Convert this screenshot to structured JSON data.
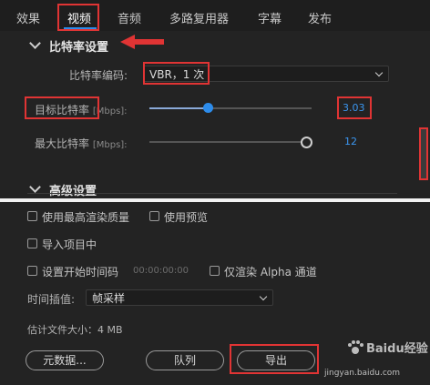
{
  "tabs": [
    {
      "label": "效果"
    },
    {
      "label": "视频"
    },
    {
      "label": "音频"
    },
    {
      "label": "多路复用器"
    },
    {
      "label": "字幕"
    },
    {
      "label": "发布"
    }
  ],
  "bitrate_section": {
    "title": "比特率设置",
    "encoding_label": "比特率编码:",
    "encoding_value": "VBR，1 次",
    "target_label": "目标比特率",
    "target_unit": "[Mbps]:",
    "target_value": "3.03",
    "target_fraction": 0.36,
    "max_label": "最大比特率",
    "max_unit": "[Mbps]:",
    "max_value": "12",
    "max_fraction": 0.97
  },
  "advanced_section": {
    "title": "高级设置"
  },
  "options": {
    "max_render_quality": "使用最高渲染质量",
    "use_previews": "使用预览",
    "import_into_project": "导入项目中",
    "set_start_timecode": "设置开始时间码",
    "timecode_value": "00:00:00:00",
    "render_alpha_only": "仅渲染 Alpha 通道"
  },
  "interpolation": {
    "label": "时间插值:",
    "value": "帧采样"
  },
  "estimate": {
    "text": "估计文件大小：4 MB"
  },
  "buttons": {
    "metadata": "元数据...",
    "queue": "队列",
    "export": "导出"
  },
  "watermark": {
    "brand": "Baidu经验",
    "url": "jingyan.baidu.com"
  },
  "colors": {
    "accent": "#2d8ceb",
    "highlight": "#e03434",
    "background": "#232323"
  }
}
